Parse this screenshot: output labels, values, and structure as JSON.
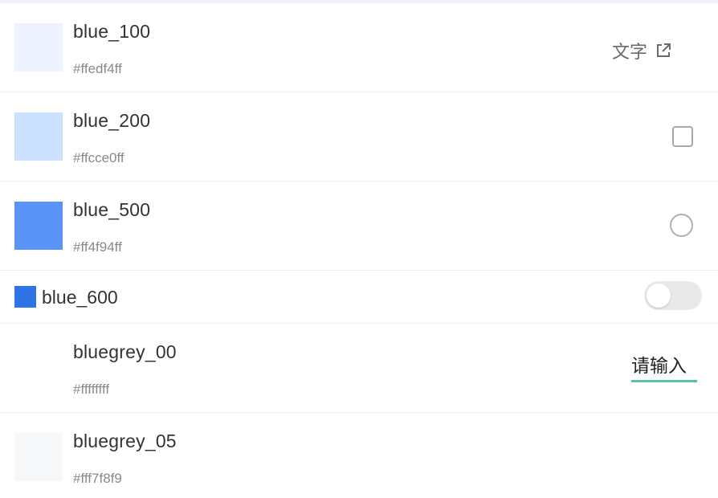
{
  "rows": [
    {
      "name": "blue_100",
      "hex": "#ffedf4ff",
      "swatch_color": "#edf4ff",
      "action": {
        "type": "link",
        "label": "文字",
        "icon": "external-link-icon"
      }
    },
    {
      "name": "blue_200",
      "hex": "#ffcce0ff",
      "swatch_color": "#cce0ff",
      "action": {
        "type": "checkbox",
        "checked": false
      }
    },
    {
      "name": "blue_500",
      "hex": "#ff4f94ff",
      "swatch_color": "#5b94f9",
      "action": {
        "type": "radio",
        "checked": false
      }
    },
    {
      "name": "blue_600",
      "swatch_color": "#2f74e6",
      "action": {
        "type": "toggle",
        "on": false
      }
    },
    {
      "name": "bluegrey_00",
      "hex": "#ffffffff",
      "swatch_color": "#ffffff",
      "action": {
        "type": "input",
        "placeholder": "请输入",
        "value": ""
      }
    },
    {
      "name": "bluegrey_05",
      "hex": "#fff7f8f9",
      "swatch_color": "#f7f8f9"
    }
  ],
  "colors": {
    "input_underline": "#58c2b1",
    "top_strip": "#eef2fa"
  }
}
